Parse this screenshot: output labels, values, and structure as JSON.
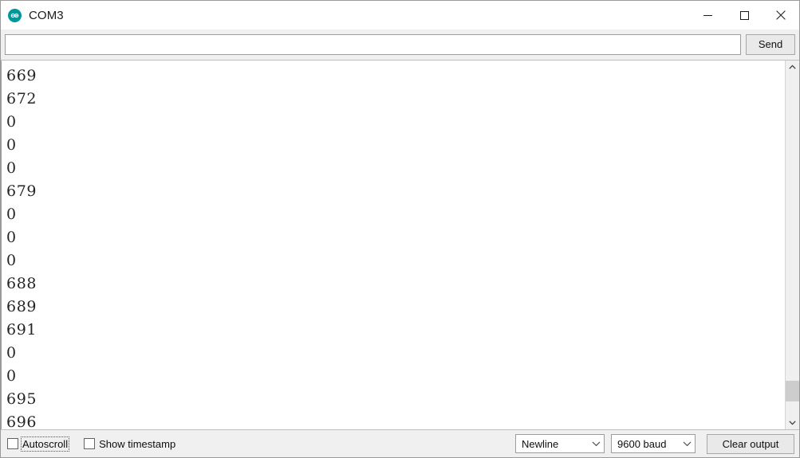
{
  "window": {
    "title": "COM3",
    "icon": "arduino-logo-icon",
    "accent_color": "#00979c",
    "controls": {
      "minimize": "minimize-icon",
      "maximize": "maximize-icon",
      "close": "close-icon"
    }
  },
  "send_row": {
    "input_value": "",
    "input_placeholder": "",
    "send_label": "Send"
  },
  "console": {
    "lines": [
      "669",
      "672",
      "0",
      "0",
      "0",
      "679",
      "0",
      "0",
      "0",
      "688",
      "689",
      "691",
      "0",
      "0",
      "695",
      "696"
    ]
  },
  "scrollbar": {
    "up_arrow": "chevron-up-icon",
    "down_arrow": "chevron-down-icon"
  },
  "status_bar": {
    "autoscroll_label": "Autoscroll",
    "autoscroll_checked": false,
    "timestamp_label": "Show timestamp",
    "timestamp_checked": false,
    "line_ending": "Newline",
    "baud_rate": "9600 baud",
    "clear_label": "Clear output"
  }
}
